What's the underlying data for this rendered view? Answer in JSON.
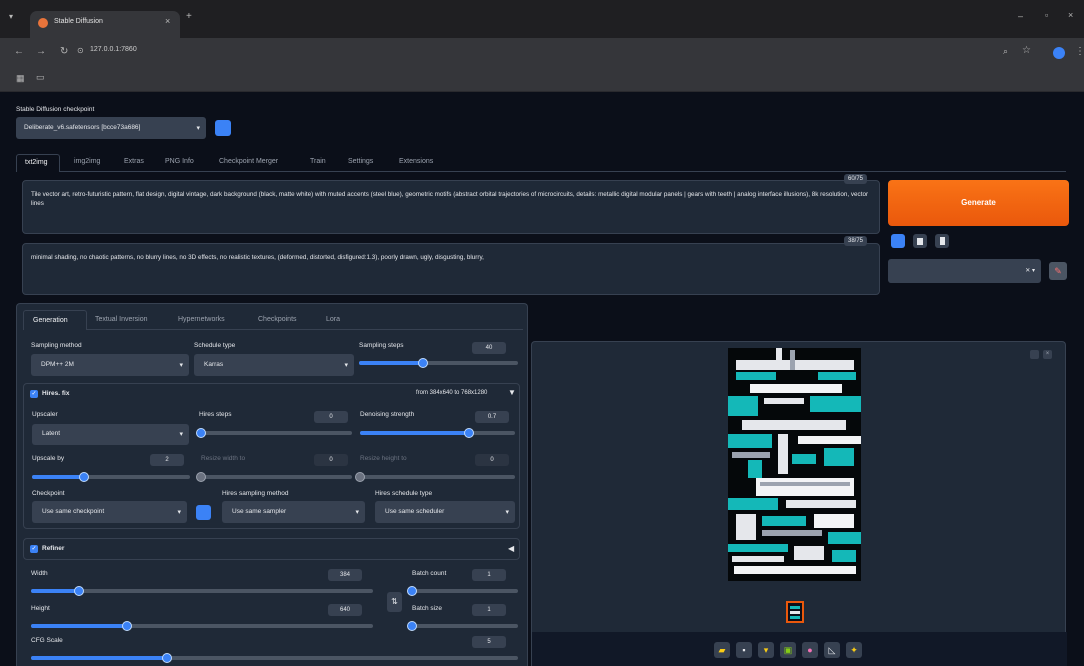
{
  "browser": {
    "tab_title": "Stable Diffusion",
    "url": "127.0.0.1:7860"
  },
  "checkpoint": {
    "label": "Stable Diffusion checkpoint",
    "value": "Deliberate_v6.safetensors [bcce73a686]"
  },
  "main_tabs": [
    "txt2img",
    "img2img",
    "Extras",
    "PNG Info",
    "Checkpoint Merger",
    "Train",
    "Settings",
    "Extensions"
  ],
  "prompt": {
    "text": "Tile vector art, retro-futuristic pattern, flat design, digital vintage, dark background (black, matte white) with muted accents (steel blue), geometric motifs (abstract orbital trajectories of microcircuits, details: metallic digital modular panels | gears with teeth | analog interface illusions), 8k resolution, vector lines",
    "token_count": "60/75"
  },
  "negative_prompt": {
    "text": "minimal shading, no chaotic patterns, no blurry lines, no 3D effects, no realistic textures, (deformed, distorted, disfigured:1.3), poorly drawn, ugly, disgusting, blurry,",
    "token_count": "38/75"
  },
  "generate_label": "Generate",
  "sub_tabs": [
    "Generation",
    "Textual Inversion",
    "Hypernetworks",
    "Checkpoints",
    "Lora"
  ],
  "sampling": {
    "method_label": "Sampling method",
    "method_value": "DPM++ 2M",
    "schedule_label": "Schedule type",
    "schedule_value": "Karras",
    "steps_label": "Sampling steps",
    "steps_value": "40",
    "steps_fraction": 0.4
  },
  "hires": {
    "label": "Hires. fix",
    "resize_info": "from 384x640 to 768x1280",
    "upscaler_label": "Upscaler",
    "upscaler_value": "Latent",
    "steps_label": "Hires steps",
    "steps_value": "0",
    "steps_fraction": 0.0,
    "denoise_label": "Denoising strength",
    "denoise_value": "0.7",
    "denoise_fraction": 0.7,
    "upscale_by_label": "Upscale by",
    "upscale_by_value": "2",
    "upscale_by_fraction": 0.33,
    "resize_width_label": "Resize width to",
    "resize_width_value": "0",
    "resize_height_label": "Resize height to",
    "resize_height_value": "0",
    "checkpoint_label": "Checkpoint",
    "checkpoint_value": "Use same checkpoint",
    "sampler_label": "Hires sampling method",
    "sampler_value": "Use same sampler",
    "scheduler_label": "Hires schedule type",
    "scheduler_value": "Use same scheduler"
  },
  "refiner_label": "Refiner",
  "size": {
    "width_label": "Width",
    "width_value": "384",
    "width_fraction": 0.14,
    "height_label": "Height",
    "height_value": "640",
    "height_fraction": 0.28,
    "batch_count_label": "Batch count",
    "batch_count_value": "1",
    "batch_size_label": "Batch size",
    "batch_size_value": "1",
    "cfg_label": "CFG Scale",
    "cfg_value": "5",
    "cfg_fraction": 0.28
  },
  "colors": {
    "accent": "#3b82f6",
    "generate": "#ea580c",
    "background": "#0b0f19"
  }
}
